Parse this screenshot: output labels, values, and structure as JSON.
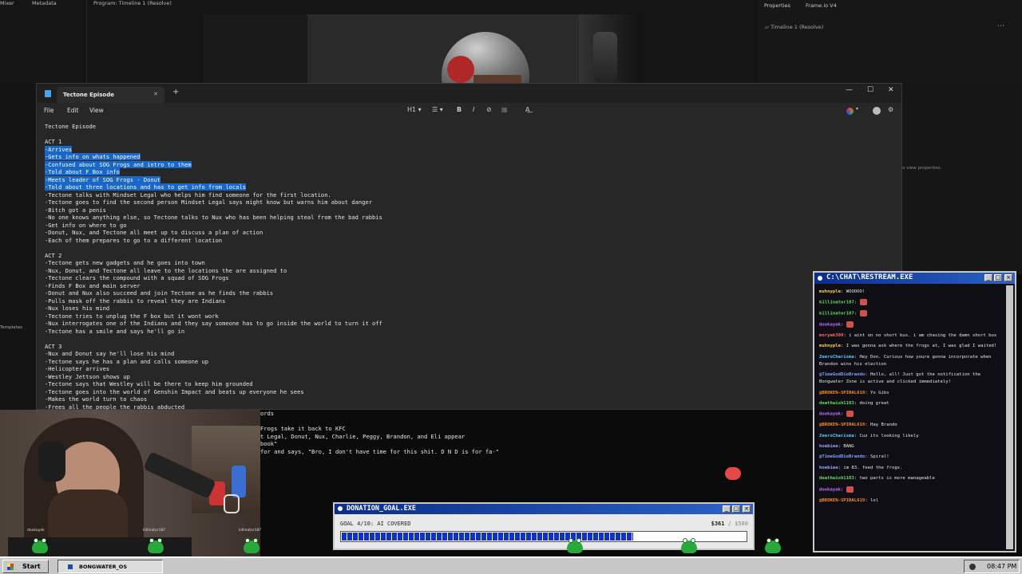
{
  "resolve": {
    "tabs": [
      "Mixer",
      "Metadata",
      "Program: Timeline 1 (Resolve)"
    ],
    "properties_tabs": [
      "Properties",
      "Frame.io V4"
    ],
    "timeline_item": "Timeline 1 (Resolve)",
    "left_labels": [
      "Templates"
    ],
    "view_props_text": "o view properties."
  },
  "notepad": {
    "tab_title": "Tectone Episode",
    "menu": [
      "File",
      "Edit",
      "View"
    ],
    "toolbar": {
      "heading": "H1",
      "list": "☰",
      "bold": "B",
      "italic": "I",
      "link": "⊘",
      "table": "▦",
      "format": "A͟"
    },
    "lines": [
      {
        "text": "Tectone Episode",
        "sel": false
      },
      {
        "text": "",
        "sel": false
      },
      {
        "text": "ACT 1",
        "sel": false
      },
      {
        "text": "-Arrives",
        "sel": true
      },
      {
        "text": "-Gets info on whats happened",
        "sel": true
      },
      {
        "text": "-Confused about SOG Frogs and intro to them",
        "sel": true
      },
      {
        "text": "-Told about F Box info",
        "sel": true
      },
      {
        "text": "-Meets leader of SOG Frogs - Donut",
        "sel": true
      },
      {
        "text": "-Told about three locations and has to get info from locals",
        "sel": true
      },
      {
        "text": "-Tectone talks with Mindset Legal who helps him find someone for the first location.",
        "sel": false
      },
      {
        "text": "-Tectone goes to find the second person Mindset Legal says might know but warns him about danger",
        "sel": false
      },
      {
        "text": "-Bitch got a penis",
        "sel": false
      },
      {
        "text": "-No one knows anything else, so Tectone talks to Nux who has been helping steal from the bad rabbis",
        "sel": false
      },
      {
        "text": "-Get info on where to go",
        "sel": false
      },
      {
        "text": "-Donut, Nux, and Tectone all meet up to discuss a plan of action",
        "sel": false
      },
      {
        "text": "-Each of them prepares to go to a different location",
        "sel": false
      },
      {
        "text": "",
        "sel": false
      },
      {
        "text": "ACT 2",
        "sel": false
      },
      {
        "text": "-Tectone gets new gadgets and he goes into town",
        "sel": false
      },
      {
        "text": "-Nux, Donut, and Tectone all leave to the locations the are assigned to",
        "sel": false
      },
      {
        "text": "-Tectone clears the compound with a squad of SOG Frogs",
        "sel": false
      },
      {
        "text": "-Finds F Box and main server",
        "sel": false
      },
      {
        "text": "-Donut and Nux also succeed and join Tectone as he finds the rabbis",
        "sel": false
      },
      {
        "text": "-Pulls mask off the rabbis to reveal they are Indians",
        "sel": false
      },
      {
        "text": "-Nux loses his mind",
        "sel": false
      },
      {
        "text": "-Tectone tries to unplug the F box but it wont work",
        "sel": false
      },
      {
        "text": "-Nux interrogates one of the Indians and they say someone has to go inside the world to turn it off",
        "sel": false
      },
      {
        "text": "-Tectone has a smile and says he'll go in",
        "sel": false
      },
      {
        "text": "",
        "sel": false
      },
      {
        "text": "ACT 3",
        "sel": false
      },
      {
        "text": "-Nux and Donut say he'll lose his mind",
        "sel": false
      },
      {
        "text": "-Tectone says he has a plan and calls someone up",
        "sel": false
      },
      {
        "text": "-Helicopter arrives",
        "sel": false
      },
      {
        "text": "-Westley Jettson shows up",
        "sel": false
      },
      {
        "text": "-Tectone says that Westley will be there to keep him grounded",
        "sel": false
      },
      {
        "text": "-Tectone goes into the world of Genshin Impact and beats up everyone he sees",
        "sel": false
      },
      {
        "text": "-Makes the world turn to chaos",
        "sel": false
      },
      {
        "text": "-Frees all the people the rabbis abducted",
        "sel": false
      }
    ],
    "overflow_lines": [
      "ords",
      "",
      "Frogs take it back to KFC",
      "t Legal, Donut, Nux, Charlie, Peggy, Brandon, and Eli appear",
      "book\"",
      "for and says, \"Bro, I don't have time for this shit. D N D is for fa-\""
    ]
  },
  "chat": {
    "title": "C:\\CHAT\\RESTREAM.EXE",
    "messages": [
      {
        "user": "muhnyple",
        "text": "WOOOOO!",
        "color": "#ffd447"
      },
      {
        "user": "killinator187",
        "text": "",
        "color": "#5fe35a",
        "emote": true
      },
      {
        "user": "killinator187",
        "text": "",
        "color": "#5fe35a",
        "emote": true
      },
      {
        "user": "dookayak",
        "text": "",
        "color": "#c070ff",
        "emote": true
      },
      {
        "user": "moryak399",
        "text": "i aint on no short bus. i am chasing the damn short bus",
        "color": "#ff6a6a"
      },
      {
        "user": "muhnyple",
        "text": "I was gonna ask where the frogs at, I was glad I waited!",
        "color": "#ffd447"
      },
      {
        "user": "ZeeroCharisma",
        "text": "Hey Don. Curious how youre gonna incorporate when Brandon wins his election",
        "color": "#4fd0ff"
      },
      {
        "user": "@TimeGodDioBrando",
        "text": "Hello, all! Just got the notification the Bongwater Zone is active and clicked immediately!",
        "color": "#7fa0ff"
      },
      {
        "user": "@BROKEN-SPIRAL619",
        "text": "Yo Gibs",
        "color": "#ff8c1a"
      },
      {
        "user": "deathwish1103",
        "text": "doing great",
        "color": "#5fe35a"
      },
      {
        "user": "dookayak",
        "text": "",
        "color": "#c070ff",
        "emote": true
      },
      {
        "user": "@BROKEN-SPIRAL619",
        "text": "Hay Brando",
        "color": "#ff8c1a"
      },
      {
        "user": "ZeeroCharisma",
        "text": "Cuz its looking likely",
        "color": "#4fd0ff"
      },
      {
        "user": "hoebiee",
        "text": "BANG",
        "color": "#9aa7ff"
      },
      {
        "user": "@TimeGodDioBrando",
        "text": "Spiral!",
        "color": "#7fa0ff"
      },
      {
        "user": "hoebiee",
        "text": "im 83. feed the frogs.",
        "color": "#9aa7ff"
      },
      {
        "user": "deathwish1103",
        "text": "two parts is more manageable",
        "color": "#5fe35a"
      },
      {
        "user": "dookayak",
        "text": "",
        "color": "#c070ff",
        "emote": true
      },
      {
        "user": "@BROKEN-SPIRAL619",
        "text": "lol",
        "color": "#ff8c1a"
      }
    ]
  },
  "donation": {
    "title": "DONATION_GOAL.EXE",
    "goal_text": "GOAL 4/10: AI COVERED",
    "current": "$361",
    "max": "/ $500",
    "progress": 0.722
  },
  "frogs": [
    {
      "name": "dookayak"
    },
    {
      "name": "killinator187"
    },
    {
      "name": "killinator187"
    },
    {
      "name": ""
    },
    {
      "name": ""
    },
    {
      "name": ""
    }
  ],
  "taskbar": {
    "start_label": "Start",
    "app_label": "BONGWATER_OS",
    "clock": "08:47 PM"
  }
}
